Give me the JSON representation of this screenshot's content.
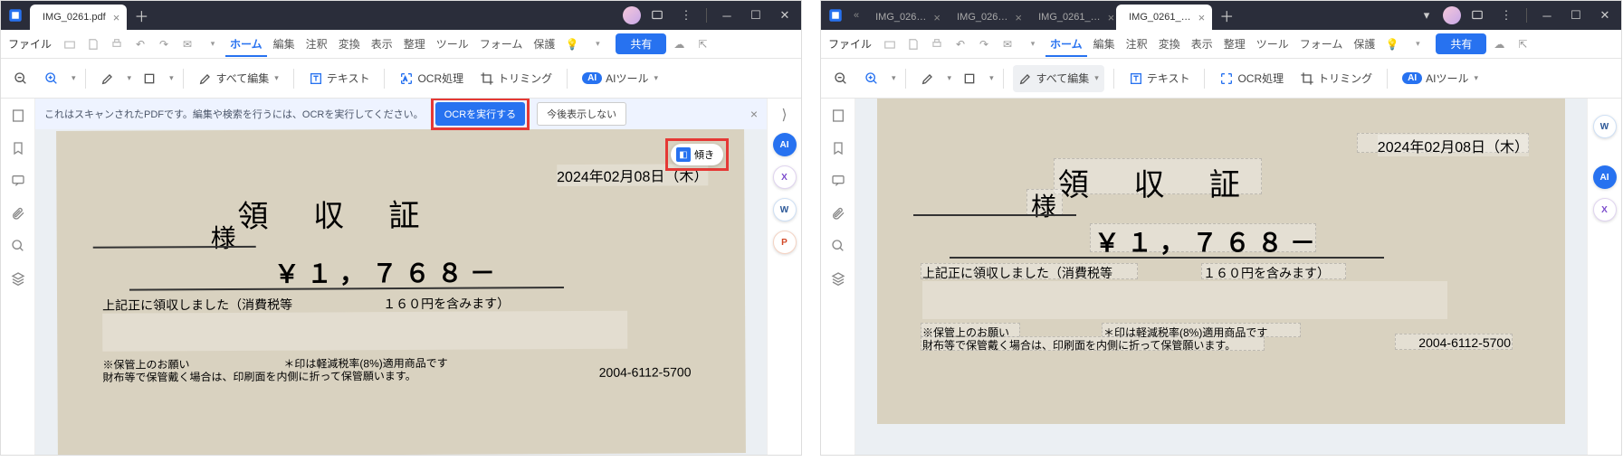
{
  "left_window": {
    "tab_title": "IMG_0261.pdf",
    "menubar": {
      "file": "ファイル",
      "tabs": [
        "ホーム",
        "編集",
        "注釈",
        "変換",
        "表示",
        "整理",
        "ツール",
        "フォーム",
        "保護"
      ],
      "share": "共有"
    },
    "toolbar": {
      "edit_all": "すべて編集",
      "text": "テキスト",
      "ocr": "OCR処理",
      "trim": "トリミング",
      "ai": "AIツール"
    },
    "banner": {
      "message": "これはスキャンされたPDFです。編集や検索を行うには、OCRを実行してください。",
      "run": "OCRを実行する",
      "dismiss": "今後表示しない"
    },
    "tilt_label": "傾き"
  },
  "right_window": {
    "tabs": [
      "IMG_026…",
      "IMG_026…",
      "IMG_0261_…",
      "IMG_0261_…"
    ],
    "menubar": {
      "file": "ファイル",
      "tabs": [
        "ホーム",
        "編集",
        "注釈",
        "変換",
        "表示",
        "整理",
        "ツール",
        "フォーム",
        "保護"
      ],
      "share": "共有"
    },
    "toolbar": {
      "edit_all": "すべて編集",
      "text": "テキスト",
      "ocr": "OCR処理",
      "trim": "トリミング",
      "ai": "AIツール"
    }
  },
  "receipt": {
    "date": "2024年02月08日（木）",
    "title": "領 収 証",
    "sama": "様",
    "amount": "￥１，７６８－",
    "confirm": "上記正に領収しました（消費税等",
    "confirm_tail": "１６０円を含みます）",
    "note1": "※保管上のお願い",
    "note2": "＊印は軽減税率(8%)適用商品です",
    "note3": "財布等で保管戴く場合は、印刷面を内側に折って保管願います。",
    "phone": "2004-6112-5700"
  },
  "rail_labels": {
    "ai": "AI",
    "x": "X",
    "w": "W",
    "p": "P"
  }
}
